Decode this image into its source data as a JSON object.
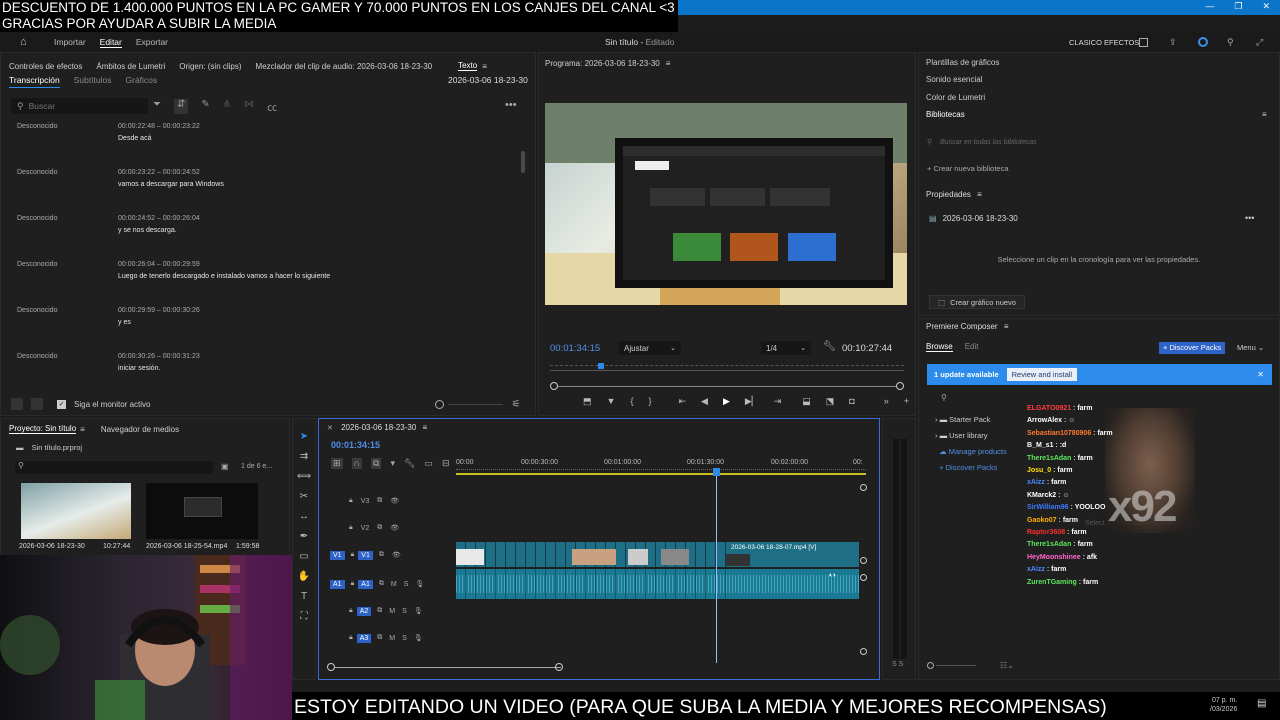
{
  "overlay": {
    "banner_line1": "DESCUENTO DE 1.400.000 PUNTOS EN LA PC GAMER Y 70.000 PUNTOS EN LOS CANJES DEL CANAL <3",
    "banner_line2": "GRACIAS POR AYUDAR A SUBIR LA MEDIA",
    "bottom_text": "ESTOY EDITANDO UN VIDEO (PARA QUE SUBA LA MEDIA Y MEJORES RECOMPENSAS)",
    "clock_time": "07 p. m.",
    "clock_date": "/03/2026"
  },
  "header": {
    "tabs": [
      "Importar",
      "Editar",
      "Exportar"
    ],
    "active_tab": "Editar",
    "project_title": "Sin título",
    "project_state": "Editado",
    "workspace": "CLASICO EFECTOS"
  },
  "panel_tabs": {
    "effect_controls": "Controles de efectos",
    "lumetri_scopes": "Ámbitos de Lumetri",
    "source": "Origen: (sin clips)",
    "audio_mixer": "Mezclador del clip de audio: 2026-03-06 18-23-30",
    "text": "Texto"
  },
  "text_panel": {
    "subtabs": [
      "Transcripción",
      "Subtítulos",
      "Gráficos"
    ],
    "sequence_name": "2026-03-06 18-23-30",
    "search_placeholder": "Buscar",
    "follow_monitor": "Siga el monitor activo",
    "segments": [
      {
        "speaker": "Desconocido",
        "time": "00:00:22:48 – 00:00:23:22",
        "text": "Desde acá"
      },
      {
        "speaker": "Desconocido",
        "time": "00:00:23:22 – 00:00:24:52",
        "text": "vamos a descargar para Windows"
      },
      {
        "speaker": "Desconocido",
        "time": "00:00:24:52 – 00:00:26:04",
        "text": "y se nos descarga."
      },
      {
        "speaker": "Desconocido",
        "time": "00:00:26:04 – 00:00:29:59",
        "text": "Luego de tenerlo descargado e instalado vamos a hacer lo siguiente"
      },
      {
        "speaker": "Desconocido",
        "time": "00:00:29:59 – 00:00:30:26",
        "text": "y es"
      },
      {
        "speaker": "Desconocido",
        "time": "00:00:30:26 – 00:00:31:23",
        "text": "iniciar sesión."
      }
    ]
  },
  "program_monitor": {
    "title": "Programa: 2026-03-06 18-23-30",
    "current_time": "00:01:34:15",
    "fit": "Ajustar",
    "resolution": "1/4",
    "duration": "00:10:27:44",
    "playhead_fraction": 0.145
  },
  "right_panels": {
    "items": [
      "Plantillas de gráficos",
      "Sonido esencial",
      "Color de Lumetri",
      "Bibliotecas"
    ],
    "library_search_placeholder": "Buscar en todas las bibliotecas",
    "new_library": "Crear nueva biblioteca",
    "properties_title": "Propiedades",
    "properties_sequence": "2026-03-06 18-23-30",
    "properties_hint": "Seleccione un clip en la cronología para ver las propiedades.",
    "new_graphic": "Crear gráfico nuevo"
  },
  "composer": {
    "title": "Premiere Composer",
    "tabs": [
      "Browse",
      "Edit"
    ],
    "discover_button": "+ Discover Packs",
    "menu": "Menu",
    "update_text": "1 update available",
    "review_button": "Review and install",
    "tree": [
      "Starter Pack",
      "User library",
      "Manage products",
      "Discover Packs"
    ],
    "search_hint": "Select an item above to search"
  },
  "chat": [
    {
      "user": "ELGATO0921",
      "msg": "farm",
      "color": "#ff3c3c"
    },
    {
      "user": "ArrowAlex",
      "msg": "",
      "color": "#ffffff"
    },
    {
      "user": "Sebastian10780906",
      "msg": "farm",
      "color": "#ff7a2f"
    },
    {
      "user": "B_M_s1",
      "msg": ":d",
      "color": "#ffffff"
    },
    {
      "user": "There1sAdan",
      "msg": "farm",
      "color": "#5ce65c"
    },
    {
      "user": "Josu_0",
      "msg": "farm",
      "color": "#ffe000"
    },
    {
      "user": "xAizz",
      "msg": "farm",
      "color": "#4a8cff"
    },
    {
      "user": "KMarck2",
      "msg": "",
      "color": "#ffffff"
    },
    {
      "user": "SirWilliam96",
      "msg": "YOOLOO",
      "color": "#3a7bff"
    },
    {
      "user": "Gaoko07",
      "msg": "farm",
      "color": "#ffb300"
    },
    {
      "user": "Raptor3608",
      "msg": "farm",
      "color": "#ff2d2d"
    },
    {
      "user": "There1sAdan",
      "msg": "farm",
      "color": "#5ce65c"
    },
    {
      "user": "HeyMoonshinee",
      "msg": "afk",
      "color": "#ff66cc"
    },
    {
      "user": "xAizz",
      "msg": "farm",
      "color": "#4a8cff"
    },
    {
      "user": "ZurenTGaming",
      "msg": "farm",
      "color": "#5ce65c"
    }
  ],
  "multiplier": "x92",
  "project_panel": {
    "title": "Proyecto: Sin título",
    "media_browser": "Navegador de medios",
    "file": "Sin título.prproj",
    "count": "1 de 6 e...",
    "items": [
      {
        "name": "2026-03-06 18-23-30",
        "duration": "10:27:44"
      },
      {
        "name": "2026-03-06 18-25-54.mp4",
        "duration": "1:59:58"
      }
    ]
  },
  "timeline": {
    "sequence": "2026-03-06 18-23-30",
    "current_time": "00:01:34:15",
    "ruler": [
      "00:00",
      "00:00:30:00",
      "00:01:00:00",
      "00:01:30:00",
      "00:02:00:00",
      "00:"
    ],
    "clip_label": "2026-03-06 18-28-07.mp4 [V]",
    "tracks": [
      {
        "name": "V3",
        "src": ""
      },
      {
        "name": "V2",
        "src": ""
      },
      {
        "name": "V1",
        "src": "V1"
      },
      {
        "name": "A1",
        "src": "A1"
      },
      {
        "name": "A2",
        "src": ""
      },
      {
        "name": "A3",
        "src": ""
      }
    ]
  },
  "colors": {
    "accent": "#2d8ceb",
    "clip_video": "#1e6f86",
    "clip_audio": "#1b7a93",
    "background": "#1d1d1d"
  }
}
